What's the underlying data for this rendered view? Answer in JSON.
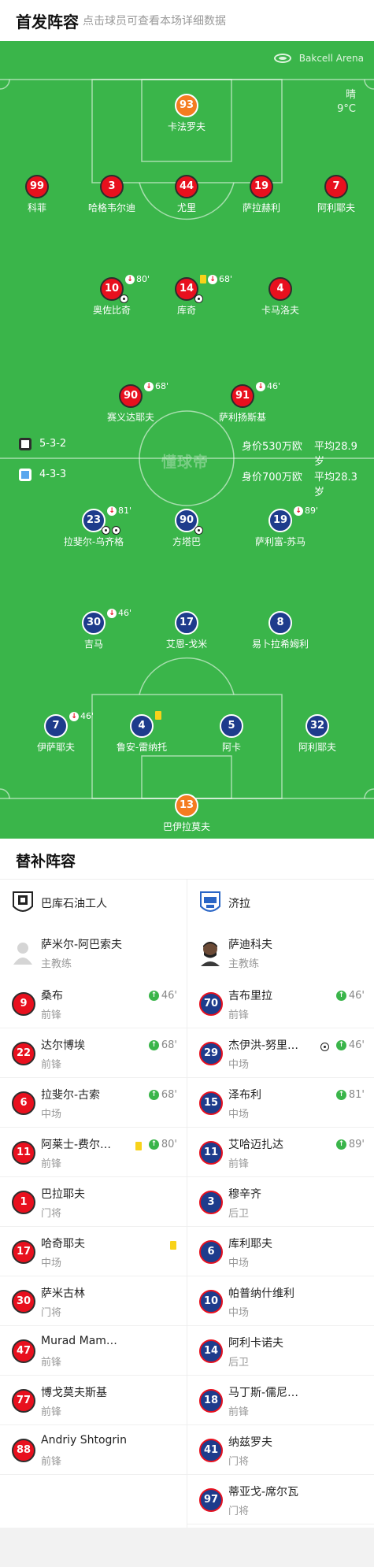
{
  "header": {
    "title": "首发阵容",
    "hint": "点击球员可查看本场详细数据"
  },
  "pitch": {
    "venue": "Bakcell Arena",
    "weather": "晴",
    "temperature": "9°C",
    "watermark": "懂球帝",
    "home_info": {
      "formation": "5-3-2",
      "value": "身价530万欧",
      "avg_age": "平均28.9岁"
    },
    "away_info": {
      "formation": "4-3-3",
      "value": "身价700万欧",
      "avg_age": "平均28.3岁"
    },
    "home_players": [
      {
        "number": "93",
        "name": "卡法罗夫",
        "gk": true
      },
      {
        "number": "99",
        "name": "科菲"
      },
      {
        "number": "3",
        "name": "哈格韦尔迪"
      },
      {
        "number": "44",
        "name": "尤里"
      },
      {
        "number": "19",
        "name": "萨拉赫利"
      },
      {
        "number": "7",
        "name": "阿利耶夫"
      },
      {
        "number": "10",
        "name": "奥佐比奇",
        "sub_out": "80'",
        "goal": true
      },
      {
        "number": "14",
        "name": "库奇",
        "sub_out": "68'",
        "yellow": true,
        "goal": true
      },
      {
        "number": "4",
        "name": "卡马洛夫"
      },
      {
        "number": "90",
        "name": "赛义达耶夫",
        "sub_out": "68'"
      },
      {
        "number": "91",
        "name": "萨利扬斯基",
        "sub_out": "46'"
      }
    ],
    "away_players": [
      {
        "number": "23",
        "name": "拉斐尔-乌齐格",
        "sub_out": "81'",
        "goals": 2
      },
      {
        "number": "90",
        "name": "方塔巴",
        "goal": true
      },
      {
        "number": "19",
        "name": "萨利富-苏马",
        "sub_out": "89'"
      },
      {
        "number": "30",
        "name": "吉马",
        "sub_out": "46'"
      },
      {
        "number": "17",
        "name": "艾恩-戈米"
      },
      {
        "number": "8",
        "name": "易卜拉希姆利"
      },
      {
        "number": "7",
        "name": "伊萨耶夫",
        "sub_out": "46'"
      },
      {
        "number": "4",
        "name": "鲁安-雷纳托",
        "yellow": true
      },
      {
        "number": "5",
        "name": "阿卡"
      },
      {
        "number": "32",
        "name": "阿利耶夫"
      },
      {
        "number": "13",
        "name": "巴伊拉莫夫",
        "gk": true
      }
    ]
  },
  "subs": {
    "title": "替补阵容",
    "home": {
      "team": "巴库石油工人",
      "coach": {
        "name": "萨米尔-阿巴索夫",
        "role": "主教练"
      },
      "players": [
        {
          "number": "9",
          "name": "桑布",
          "position": "前锋",
          "sub_in": "46'"
        },
        {
          "number": "22",
          "name": "达尔博埃",
          "position": "前锋",
          "sub_in": "68'"
        },
        {
          "number": "6",
          "name": "拉斐尔-古索",
          "position": "中场",
          "sub_in": "68'"
        },
        {
          "number": "11",
          "name": "阿莱士-费尔…",
          "position": "前锋",
          "sub_in": "80'",
          "yellow": true
        },
        {
          "number": "1",
          "name": "巴拉耶夫",
          "position": "门将"
        },
        {
          "number": "17",
          "name": "哈奇耶夫",
          "position": "中场",
          "yellow": true
        },
        {
          "number": "30",
          "name": "萨米古林",
          "position": "门将"
        },
        {
          "number": "47",
          "name": "Murad Mam…",
          "position": "前锋"
        },
        {
          "number": "77",
          "name": "博戈莫夫斯基",
          "position": "前锋"
        },
        {
          "number": "88",
          "name": "Andriy Shtogrin",
          "position": "前锋"
        }
      ]
    },
    "away": {
      "team": "济拉",
      "coach": {
        "name": "萨迪科夫",
        "role": "主教练"
      },
      "players": [
        {
          "number": "70",
          "name": "吉布里拉",
          "position": "前锋",
          "sub_in": "46'"
        },
        {
          "number": "29",
          "name": "杰伊洪-努里…",
          "position": "中场",
          "sub_in": "46'",
          "goal": true
        },
        {
          "number": "15",
          "name": "泽布利",
          "position": "中场",
          "sub_in": "81'"
        },
        {
          "number": "11",
          "name": "艾哈迈扎达",
          "position": "前锋",
          "sub_in": "89'"
        },
        {
          "number": "3",
          "name": "穆辛齐",
          "position": "后卫"
        },
        {
          "number": "6",
          "name": "库利耶夫",
          "position": "中场"
        },
        {
          "number": "10",
          "name": "帕普纳什维利",
          "position": "中场"
        },
        {
          "number": "14",
          "name": "阿利卡诺夫",
          "position": "后卫"
        },
        {
          "number": "18",
          "name": "马丁斯-儒尼…",
          "position": "前锋"
        },
        {
          "number": "41",
          "name": "纳兹罗夫",
          "position": "门将"
        },
        {
          "number": "97",
          "name": "蒂亚戈-席尔瓦",
          "position": "门将"
        }
      ]
    }
  },
  "colors": {
    "pitch": "#3ab54a",
    "home": "#e8101e",
    "away": "#1e3c8c",
    "goalkeeper": "#f47c20",
    "yellow_card": "#f8d21a"
  },
  "icons": [
    "stadium-icon",
    "sub-out-icon",
    "sub-in-icon",
    "yellow-card-icon",
    "goal-ball-icon",
    "home-shirt-icon",
    "away-shirt-icon",
    "home-crest-icon",
    "away-crest-icon",
    "coach-avatar"
  ]
}
